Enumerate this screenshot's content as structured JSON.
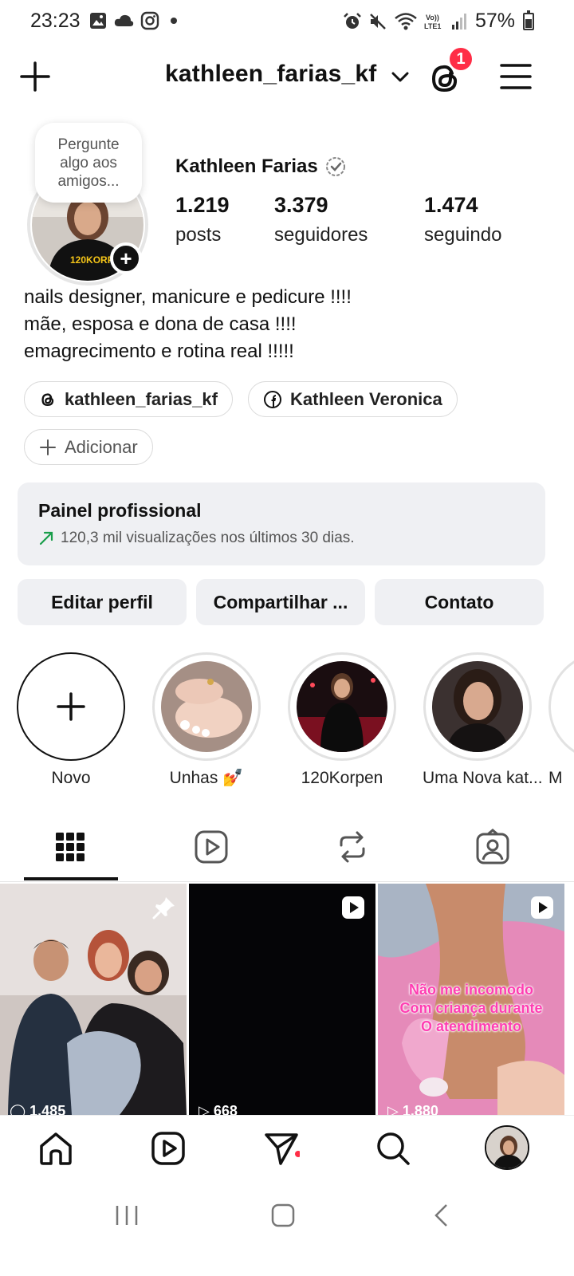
{
  "status_bar": {
    "time": "23:23",
    "battery": "57%",
    "icons": [
      "gallery-icon",
      "cloud-icon",
      "instagram-icon",
      "dot-icon",
      "alarm-icon",
      "mute-icon",
      "wifi-icon",
      "lte-icon",
      "signal-icon",
      "battery-icon"
    ],
    "battery_level": 0.57
  },
  "header": {
    "username": "kathleen_farias_kf",
    "notification_count": "1"
  },
  "profile": {
    "note": "Pergunte algo aos amigos...",
    "display_name": "Kathleen Farias",
    "stats": [
      {
        "value": "1.219",
        "label": "posts"
      },
      {
        "value": "3.379",
        "label": "seguidores"
      },
      {
        "value": "1.474",
        "label": "seguindo"
      }
    ],
    "bio": [
      "nails designer,  manicure e pedicure !!!!",
      "mãe,  esposa e dona de casa !!!!",
      "emagrecimento e rotina real !!!!!"
    ],
    "links": [
      {
        "icon": "threads-icon",
        "label": "kathleen_farias_kf"
      },
      {
        "icon": "facebook-icon",
        "label": "Kathleen Veronica"
      }
    ],
    "add_link_label": "Adicionar"
  },
  "panel": {
    "title": "Painel profissional",
    "subtitle": "120,3 mil visualizações nos últimos 30 dias."
  },
  "actions": {
    "edit": "Editar perfil",
    "share": "Compartilhar ...",
    "contact": "Contato"
  },
  "highlights": [
    {
      "label": "Novo"
    },
    {
      "label": "Unhas 💅"
    },
    {
      "label": "120Korpen"
    },
    {
      "label": "Uma Nova kat..."
    },
    {
      "label": "M"
    }
  ],
  "grid": [
    {
      "type": "pinned-post",
      "views": "1.485"
    },
    {
      "type": "reel",
      "views": "668"
    },
    {
      "type": "reel",
      "views": "1.880",
      "caption": [
        "Não me incomodo",
        "Com criança durante",
        "O atendimento"
      ]
    }
  ],
  "colors": {
    "accent_badge": "#ff2d46",
    "trend_green": "#1a9e4b",
    "panel_bg": "#eff0f3",
    "reel_caption": "#ff3db2"
  }
}
